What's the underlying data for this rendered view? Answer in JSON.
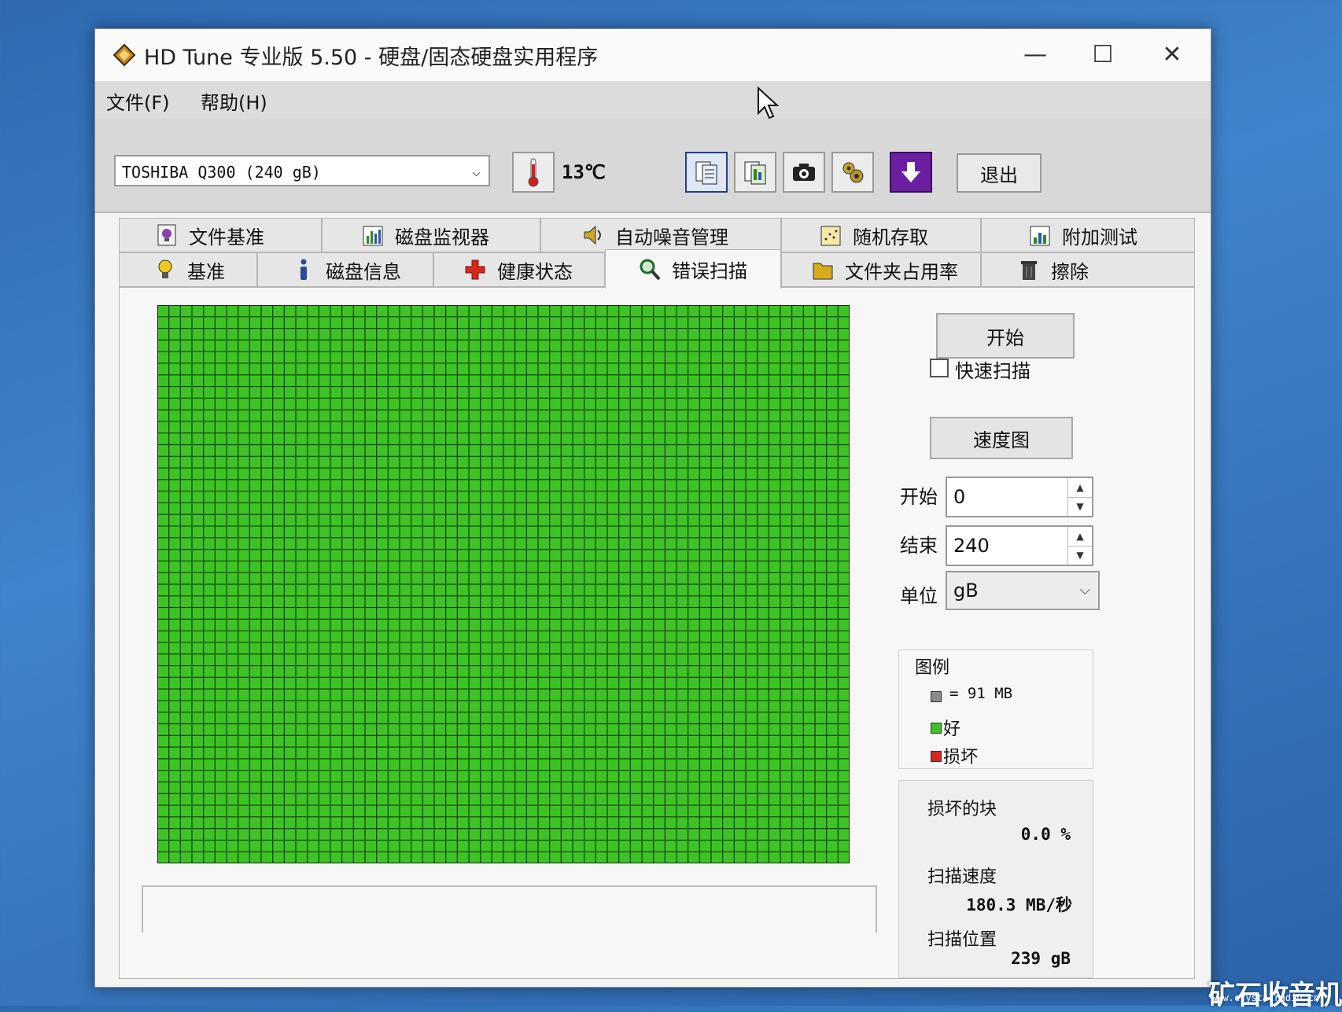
{
  "window": {
    "title": "HD Tune 专业版 5.50 - 硬盘/固态硬盘实用程序",
    "minimize": "—",
    "maximize": "☐",
    "close": "✕"
  },
  "menu": [
    "文件(F)",
    "帮助(H)"
  ],
  "toolbar": {
    "drive": "TOSHIBA Q300 (240 gB)",
    "temperature": "13℃",
    "exit_label": "退出",
    "icons": [
      "copy-info-icon",
      "copy-all-icon",
      "screenshot-icon",
      "options-icon",
      "save-icon"
    ]
  },
  "tabs_top": [
    {
      "label": "文件基准",
      "icon": "file-benchmark-icon"
    },
    {
      "label": "磁盘监视器",
      "icon": "disk-monitor-icon"
    },
    {
      "label": "自动噪音管理",
      "icon": "speaker-icon"
    },
    {
      "label": "随机存取",
      "icon": "random-access-icon"
    },
    {
      "label": "附加测试",
      "icon": "extra-tests-icon"
    }
  ],
  "tabs_bottom": [
    {
      "label": "基准",
      "icon": "benchmark-icon"
    },
    {
      "label": "磁盘信息",
      "icon": "info-icon"
    },
    {
      "label": "健康状态",
      "icon": "health-cross-icon"
    },
    {
      "label": "错误扫描",
      "icon": "magnifier-icon",
      "selected": true
    },
    {
      "label": "文件夹占用率",
      "icon": "folder-icon"
    },
    {
      "label": "擦除",
      "icon": "trash-icon"
    }
  ],
  "scan": {
    "start_button": "开始",
    "quick_scan_label": "快速扫描",
    "quick_scan_checked": false,
    "speed_map_button": "速度图",
    "start_label": "开始",
    "start_value": "0",
    "end_label": "结束",
    "end_value": "240",
    "unit_label": "单位",
    "unit_value": "gB",
    "legend_title": "图例",
    "legend_block": "= 91 MB",
    "legend_good": "好",
    "legend_bad": "损坏",
    "colors": {
      "good": "#3dc424",
      "bad": "#d8261c",
      "block": "#8a8a8a"
    },
    "bad_blocks_label": "损坏的块",
    "bad_blocks_value": "0.0 %",
    "scan_speed_label": "扫描速度",
    "scan_speed_value": "180.3 MB/秒",
    "scan_position_label": "扫描位置",
    "scan_position_value": "239 gB"
  },
  "watermark": {
    "text": "矿石收音机",
    "url": "www.crystalradio.cn"
  }
}
